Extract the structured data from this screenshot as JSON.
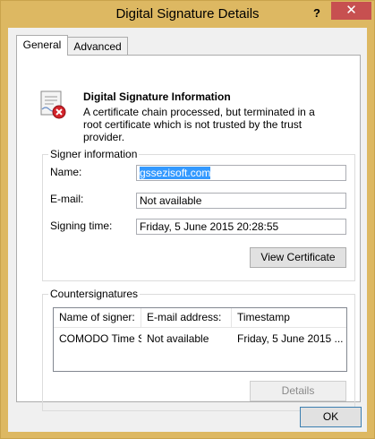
{
  "window": {
    "title": "Digital Signature Details",
    "help_label": "?",
    "close_label": "✕"
  },
  "tabs": [
    {
      "label": "General",
      "selected": true
    },
    {
      "label": "Advanced",
      "selected": false
    }
  ],
  "info": {
    "icon": "certificate-error-icon",
    "heading": "Digital Signature Information",
    "message": "A certificate chain processed, but terminated in a root certificate which is not trusted by the trust provider."
  },
  "signer": {
    "group_label": "Signer information",
    "fields": [
      {
        "label": "Name:",
        "value": "gssezisoft.com"
      },
      {
        "label": "E-mail:",
        "value": "Not available"
      },
      {
        "label": "Signing time:",
        "value": "Friday, 5 June 2015 20:28:55"
      }
    ],
    "view_certificate_label": "View Certificate"
  },
  "countersignatures": {
    "group_label": "Countersignatures",
    "columns": [
      "Name of signer:",
      "E-mail address:",
      "Timestamp"
    ],
    "rows": [
      [
        "COMODO Time S...",
        "Not available",
        "Friday, 5 June 2015 ..."
      ]
    ],
    "details_label": "Details"
  },
  "footer": {
    "ok_label": "OK"
  }
}
